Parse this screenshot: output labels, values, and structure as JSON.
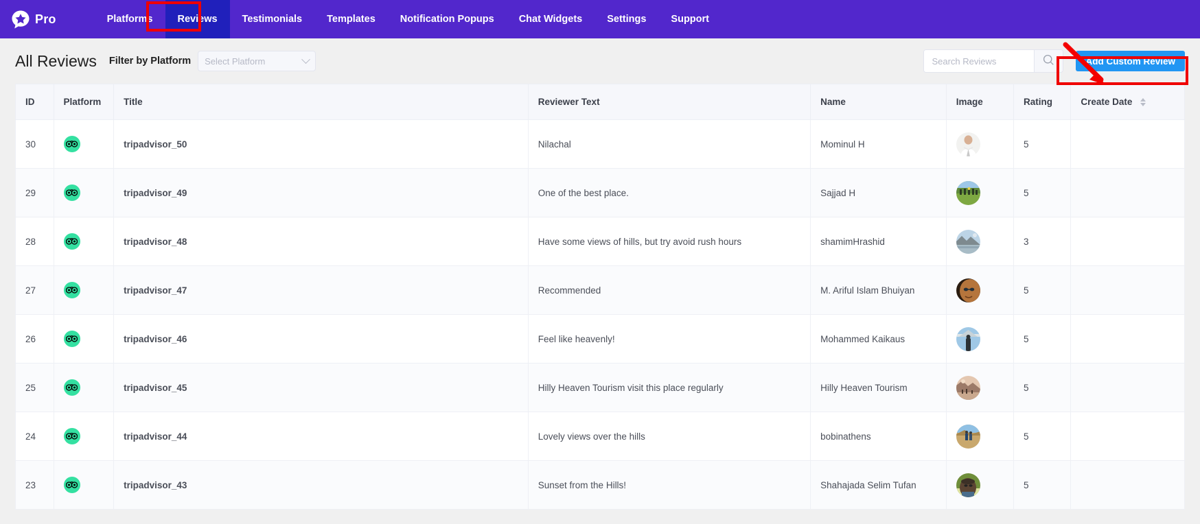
{
  "brand": {
    "name": "Pro",
    "logo_icon": "star-speech-bubble-icon"
  },
  "nav": {
    "items": [
      {
        "label": "Platforms",
        "active": false
      },
      {
        "label": "Reviews",
        "active": true
      },
      {
        "label": "Testimonials",
        "active": false
      },
      {
        "label": "Templates",
        "active": false
      },
      {
        "label": "Notification Popups",
        "active": false
      },
      {
        "label": "Chat Widgets",
        "active": false
      },
      {
        "label": "Settings",
        "active": false
      },
      {
        "label": "Support",
        "active": false
      }
    ]
  },
  "subheader": {
    "page_title": "All Reviews",
    "filter_label": "Filter by Platform",
    "platform_select_value": "Select Platform",
    "search_placeholder": "Search Reviews",
    "search_value": "",
    "search_icon": "search-icon",
    "add_button_label": "Add Custom Review"
  },
  "annotations": {
    "nav_highlight_target": "Reviews",
    "button_highlight_target": "Add Custom Review",
    "highlight_color": "#ef0000",
    "arrow_color": "#f40000"
  },
  "colors": {
    "nav_background": "#5227cc",
    "nav_active": "#2020bb",
    "add_button": "#2196f3",
    "tripadvisor_green": "#34e0a1",
    "page_background": "#f0f0f0"
  },
  "table": {
    "columns": [
      {
        "key": "id",
        "label": "ID",
        "sortable": false
      },
      {
        "key": "platform",
        "label": "Platform",
        "sortable": false
      },
      {
        "key": "title",
        "label": "Title",
        "sortable": false
      },
      {
        "key": "reviewer_text",
        "label": "Reviewer Text",
        "sortable": false
      },
      {
        "key": "name",
        "label": "Name",
        "sortable": false
      },
      {
        "key": "image",
        "label": "Image",
        "sortable": false
      },
      {
        "key": "rating",
        "label": "Rating",
        "sortable": false
      },
      {
        "key": "create_date",
        "label": "Create Date",
        "sortable": true
      }
    ],
    "rows": [
      {
        "id": "30",
        "platform": "tripadvisor",
        "title": "tripadvisor_50",
        "reviewer_text": "Nilachal",
        "name": "Mominul H",
        "rating": "5",
        "create_date": "",
        "avatar": "man-white-shirt"
      },
      {
        "id": "29",
        "platform": "tripadvisor",
        "title": "tripadvisor_49",
        "reviewer_text": "One of the best place.",
        "name": "Sajjad H",
        "rating": "5",
        "create_date": "",
        "avatar": "group-field"
      },
      {
        "id": "28",
        "platform": "tripadvisor",
        "title": "tripadvisor_48",
        "reviewer_text": "Have some views of hills, but try avoid rush hours",
        "name": "shamimHrashid",
        "rating": "3",
        "create_date": "",
        "avatar": "mountain-lake"
      },
      {
        "id": "27",
        "platform": "tripadvisor",
        "title": "tripadvisor_47",
        "reviewer_text": "Recommended",
        "name": "M. Ariful Islam Bhuiyan",
        "rating": "5",
        "create_date": "",
        "avatar": "man-glasses"
      },
      {
        "id": "26",
        "platform": "tripadvisor",
        "title": "tripadvisor_46",
        "reviewer_text": "Feel like heavenly!",
        "name": "Mohammed Kaikaus",
        "rating": "5",
        "create_date": "",
        "avatar": "person-sky"
      },
      {
        "id": "25",
        "platform": "tripadvisor",
        "title": "tripadvisor_45",
        "reviewer_text": "Hilly Heaven Tourism visit this place regularly",
        "name": "Hilly Heaven Tourism",
        "rating": "5",
        "create_date": "",
        "avatar": "mountain-sunset"
      },
      {
        "id": "24",
        "platform": "tripadvisor",
        "title": "tripadvisor_44",
        "reviewer_text": "Lovely views over the hills",
        "name": "bobinathens",
        "rating": "5",
        "create_date": "",
        "avatar": "hill-people"
      },
      {
        "id": "23",
        "platform": "tripadvisor",
        "title": "tripadvisor_43",
        "reviewer_text": "Sunset from the Hills!",
        "name": "Shahajada Selim Tufan",
        "rating": "5",
        "create_date": "",
        "avatar": "man-hat"
      }
    ]
  }
}
